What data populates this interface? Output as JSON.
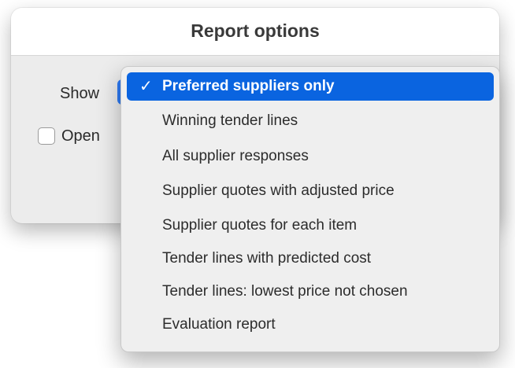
{
  "dialog": {
    "title": "Report options",
    "show_label": "Show",
    "checkbox_label": "Open",
    "checkbox_checked": false
  },
  "menu": {
    "selected_index": 0,
    "check_mark": "✓",
    "items": [
      {
        "label": "Preferred suppliers only"
      },
      {
        "label": "Winning tender lines"
      },
      {
        "label": "All supplier responses"
      },
      {
        "label": "Supplier quotes with adjusted price"
      },
      {
        "label": "Supplier quotes for each item"
      },
      {
        "label": "Tender lines with predicted cost"
      },
      {
        "label": "Tender lines: lowest price not chosen"
      },
      {
        "label": "Evaluation report"
      }
    ]
  },
  "colors": {
    "accent": "#0a64e0",
    "dialog_bg": "#ececec",
    "menu_bg": "#efefef"
  }
}
